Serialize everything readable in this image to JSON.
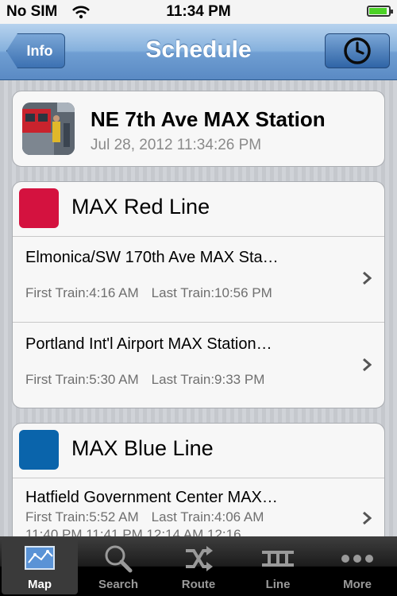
{
  "status": {
    "carrier": "No SIM",
    "time": "11:34 PM",
    "battery_level": 0.9
  },
  "nav": {
    "title": "Schedule",
    "back_label": "Info",
    "right_icon": "clock-icon"
  },
  "station": {
    "name": "NE 7th Ave MAX Station",
    "timestamp": "Jul 28, 2012 11:34:26 PM"
  },
  "lines": [
    {
      "name": "MAX Red Line",
      "color": "#d4123f",
      "rows": [
        {
          "destination": "Elmonica/SW 170th Ave MAX Sta…",
          "first": "First Train:4:16 AM",
          "last": "Last Train:10:56 PM"
        },
        {
          "destination": "Portland Int'l Airport MAX Station…",
          "first": "First Train:5:30 AM",
          "last": "Last Train:9:33 PM"
        }
      ]
    },
    {
      "name": "MAX Blue Line",
      "color": "#0a64ab",
      "rows": [
        {
          "destination": "Hatfield Government Center MAX…",
          "first": "First Train:5:52 AM",
          "last": "Last Train:4:06 AM",
          "extra": "11:40 PM   11:41 PM   12:14 AM   12:16"
        }
      ]
    }
  ],
  "tabs": [
    {
      "label": "Map",
      "icon": "map-icon",
      "active": true
    },
    {
      "label": "Search",
      "icon": "search-icon",
      "active": false
    },
    {
      "label": "Route",
      "icon": "shuffle-icon",
      "active": false
    },
    {
      "label": "Line",
      "icon": "rail-icon",
      "active": false
    },
    {
      "label": "More",
      "icon": "more-icon",
      "active": false
    }
  ]
}
